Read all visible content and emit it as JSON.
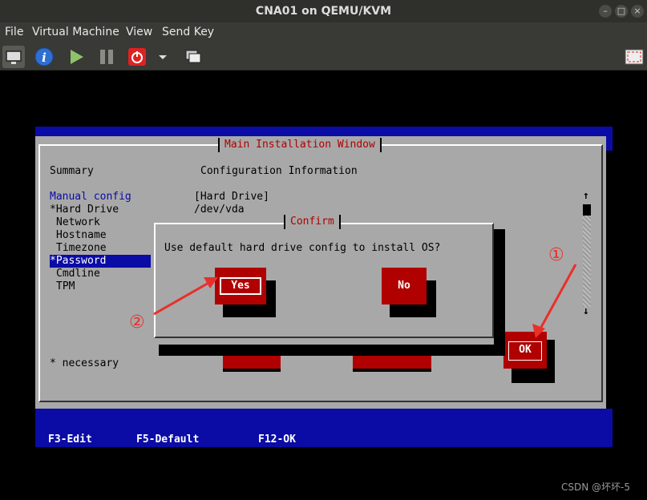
{
  "window": {
    "title": "CNA01 on QEMU/KVM"
  },
  "menu": {
    "file": "File",
    "virtual_machine": "Virtual Machine",
    "view": "View",
    "send_key": "Send Key"
  },
  "toolbar": {
    "icons": [
      "monitor-icon",
      "info-icon",
      "play-icon",
      "pause-icon",
      "power-icon",
      "dropdown-icon",
      "snapshot-icon",
      "fullscreen-icon"
    ]
  },
  "installer": {
    "window_title": "Main Installation Window",
    "summary_label": "Summary",
    "config_info_label": "Configuration Information",
    "menu_items": [
      "Manual config",
      "*Hard Drive",
      "Network",
      "Hostname",
      "Timezone",
      "*Password",
      "Cmdline",
      "TPM"
    ],
    "selected_item": "*Password",
    "config_values": [
      "[Hard Drive]",
      "/dev/vda"
    ],
    "necessary_note": "* necessary",
    "ok_label": "OK",
    "scroll_up": "↑",
    "scroll_down": "↓"
  },
  "confirm_dialog": {
    "title": "Confirm",
    "message": "Use default hard drive config to install OS?",
    "yes_label": "Yes",
    "no_label": "No"
  },
  "footer": {
    "f3": "F3-Edit",
    "f5": "F5-Default",
    "f12": "F12-OK"
  },
  "annotations": {
    "marker_1": "①",
    "marker_2": "②",
    "arrow_color": "#e8302a"
  },
  "watermark": "CSDN @坏坏-5",
  "colors": {
    "installer_blue": "#0b0ba6",
    "installer_gray": "#a8a8a8",
    "button_red": "#b00000",
    "title_red": "#b00000"
  }
}
